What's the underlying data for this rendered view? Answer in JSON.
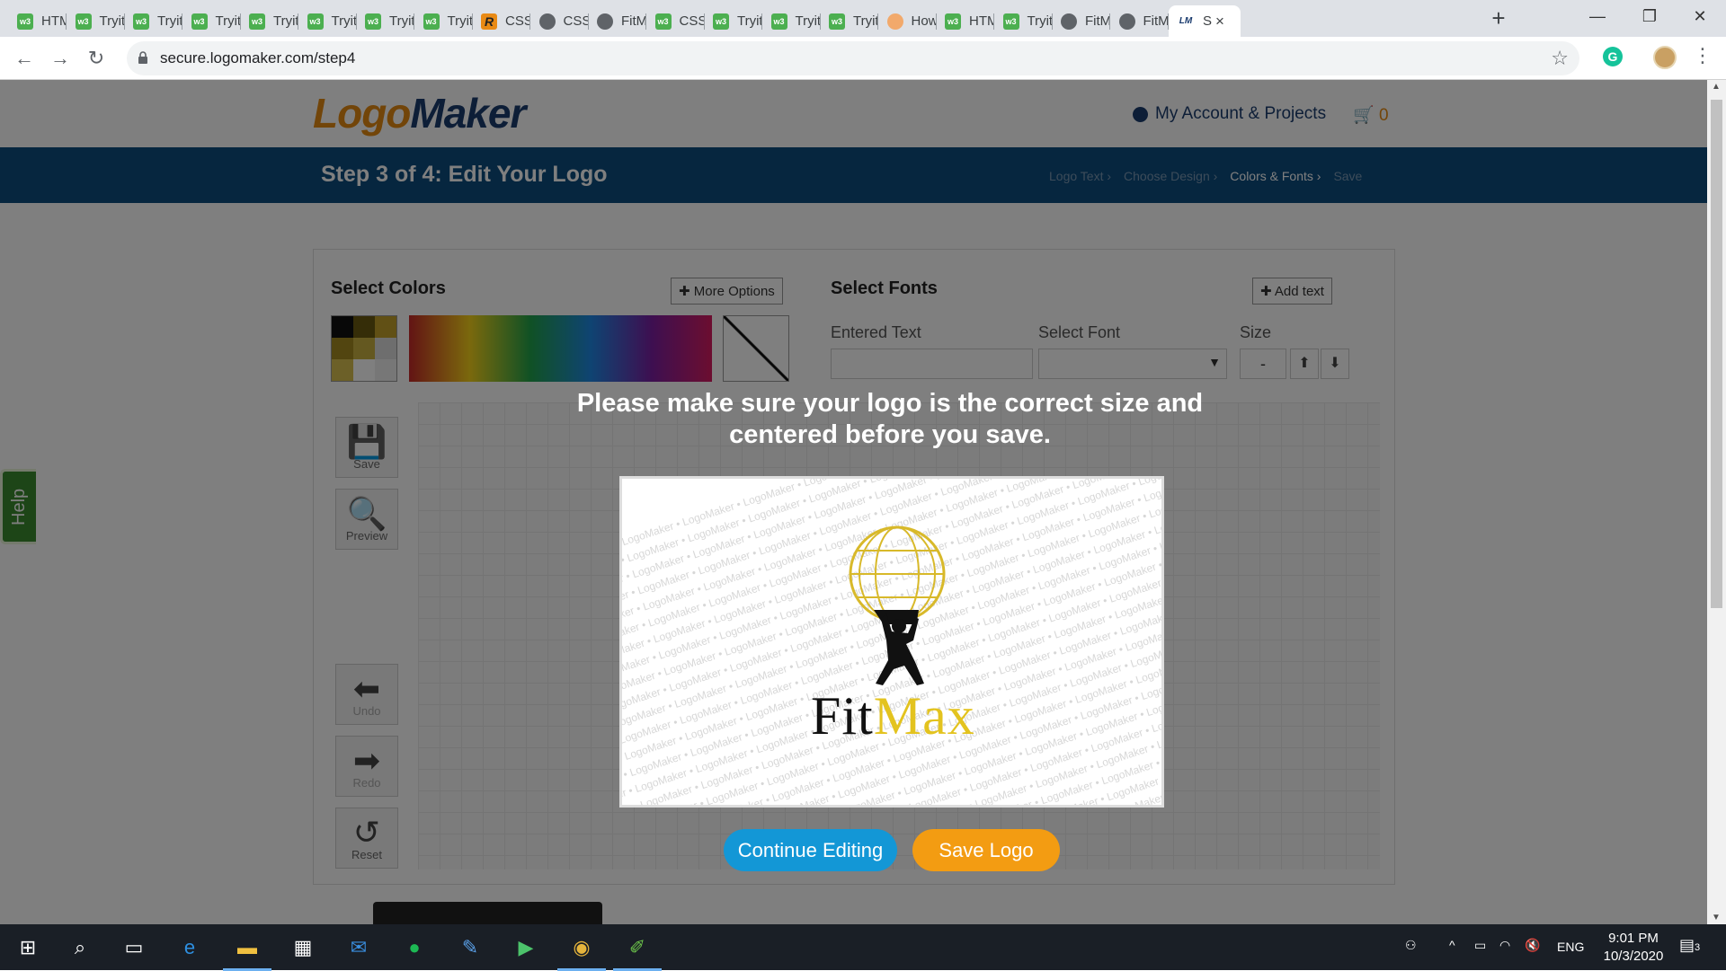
{
  "browser": {
    "tabs": [
      {
        "label": "HTM",
        "icon": "w3-icon"
      },
      {
        "label": "Tryit",
        "icon": "w3-icon"
      },
      {
        "label": "Tryit",
        "icon": "w3-icon"
      },
      {
        "label": "Tryit",
        "icon": "w3-icon"
      },
      {
        "label": "Tryit",
        "icon": "w3-icon"
      },
      {
        "label": "Tryit",
        "icon": "w3-icon"
      },
      {
        "label": "Tryit",
        "icon": "w3-icon"
      },
      {
        "label": "Tryit",
        "icon": "w3-icon"
      },
      {
        "label": "CSS",
        "icon": "r-icon"
      },
      {
        "label": "CSS",
        "icon": "globe-icon"
      },
      {
        "label": "FitM",
        "icon": "globe-icon"
      },
      {
        "label": "CSS",
        "icon": "w3-icon"
      },
      {
        "label": "Tryit",
        "icon": "w3-icon"
      },
      {
        "label": "Tryit",
        "icon": "w3-icon"
      },
      {
        "label": "Tryit",
        "icon": "w3-icon"
      },
      {
        "label": "How",
        "icon": "how-icon"
      },
      {
        "label": "HTM",
        "icon": "w3-icon"
      },
      {
        "label": "Tryit",
        "icon": "w3-icon"
      },
      {
        "label": "FitM",
        "icon": "globe-icon"
      },
      {
        "label": "FitM",
        "icon": "globe-icon"
      },
      {
        "label": "S",
        "icon": "lm-icon",
        "active": true
      }
    ],
    "url": "secure.logomaker.com/step4"
  },
  "site": {
    "logo_part1": "Logo",
    "logo_part2": "Maker",
    "account_label": "My Account & Projects",
    "cart_count": "0",
    "step_title": "Step 3 of 4: Edit Your Logo",
    "breadcrumbs": [
      "Logo Text",
      "Choose Design",
      "Colors & Fonts",
      "Save"
    ],
    "breadcrumb_current": "Colors & Fonts"
  },
  "editor": {
    "colors_title": "Select Colors",
    "more_options": "More Options",
    "fonts_title": "Select Fonts",
    "add_text": "Add text",
    "entered_text_label": "Entered Text",
    "select_font_label": "Select Font",
    "size_label": "Size",
    "size_minus": "-",
    "tools": [
      "Save",
      "Preview",
      "Undo",
      "Redo",
      "Reset"
    ],
    "help": "Help"
  },
  "modal": {
    "message_line1": "Please make sure your logo is the correct size and",
    "message_line2": "centered before you save.",
    "watermark": "LogoMaker",
    "brand_part1": "Fit",
    "brand_part2": "Max",
    "continue_label": "Continue Editing",
    "save_label": "Save Logo"
  },
  "taskbar": {
    "lang": "ENG",
    "time": "9:01 PM",
    "date": "10/3/2020",
    "notifications": "3"
  },
  "colors": {
    "brand_orange": "#e58b12",
    "brand_navy": "#1b3d6f",
    "continue_blue": "#1397d6",
    "save_orange": "#f39c12",
    "logo_gold": "#e3c31f"
  }
}
